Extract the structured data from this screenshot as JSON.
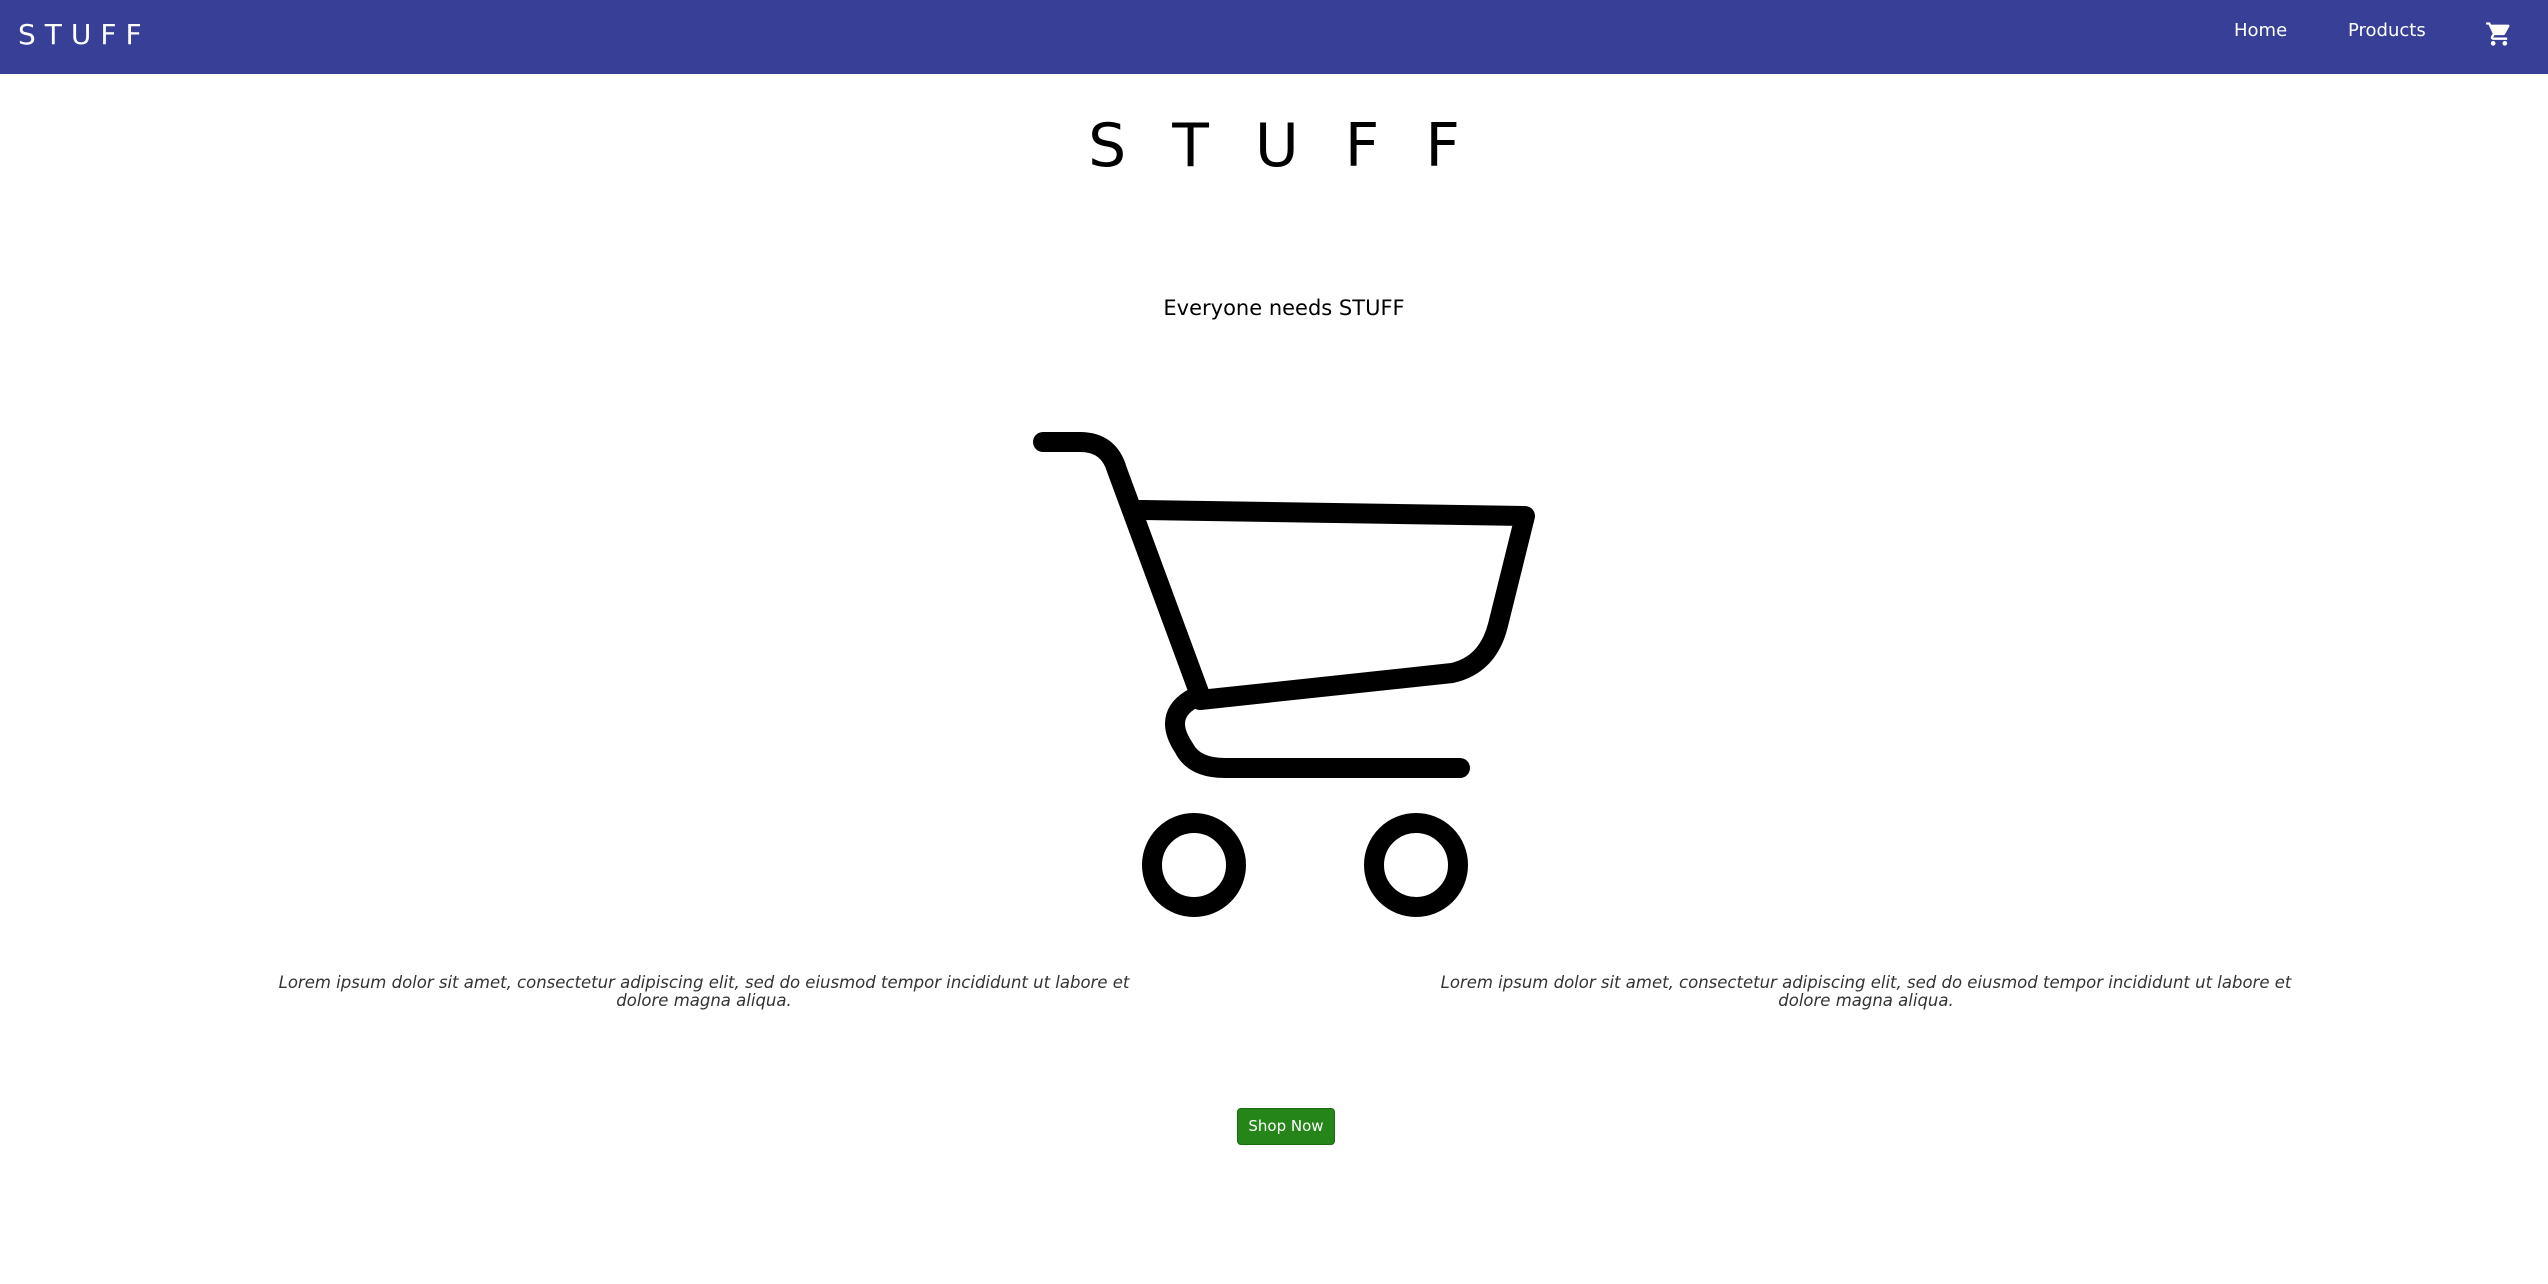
{
  "navbar": {
    "brand": "STUFF",
    "links": [
      {
        "label": "Home"
      },
      {
        "label": "Products"
      }
    ],
    "cart_icon": "shopping-cart-icon",
    "background_color": "#373f97"
  },
  "hero": {
    "title": "STUFF",
    "tagline": "Everyone needs STUFF",
    "image_icon": "shopping-cart-icon"
  },
  "features": [
    {
      "text": "Lorem ipsum dolor sit amet, consectetur adipiscing elit, sed do eiusmod tempor incididunt ut labore et dolore magna aliqua."
    },
    {
      "text": "Lorem ipsum dolor sit amet, consectetur adipiscing elit, sed do eiusmod tempor incididunt ut labore et dolore magna aliqua."
    }
  ],
  "cta": {
    "label": "Shop Now",
    "color": "#258519"
  }
}
